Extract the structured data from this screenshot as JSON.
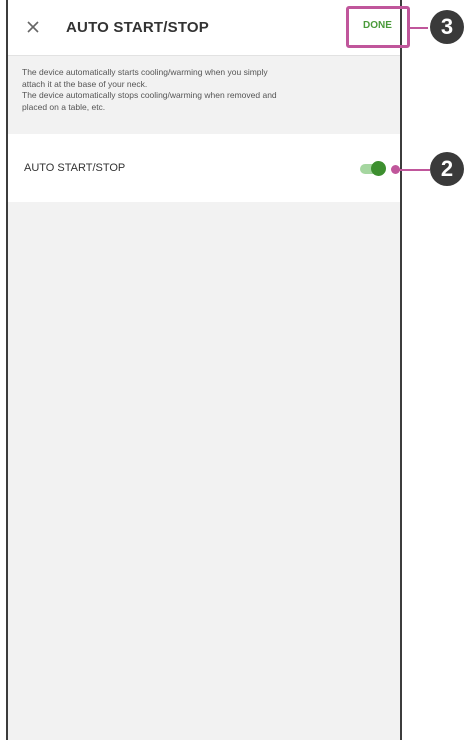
{
  "header": {
    "close_icon": "close-icon",
    "title": "AUTO START/STOP",
    "done_label": "DONE"
  },
  "description": {
    "line1": "The device automatically starts cooling/warming when you simply",
    "line2": "attach it at the base of your neck.",
    "line3": "The device automatically stops cooling/warming when removed and",
    "line4": "placed on a table, etc."
  },
  "setting": {
    "label": "AUTO START/STOP",
    "toggle_on": true
  },
  "callouts": {
    "done_marker": "3",
    "toggle_marker": "2"
  },
  "colors": {
    "accent_green": "#3d8f2f",
    "callout_magenta": "#c0569b",
    "badge_dark": "#3a3a3a"
  }
}
